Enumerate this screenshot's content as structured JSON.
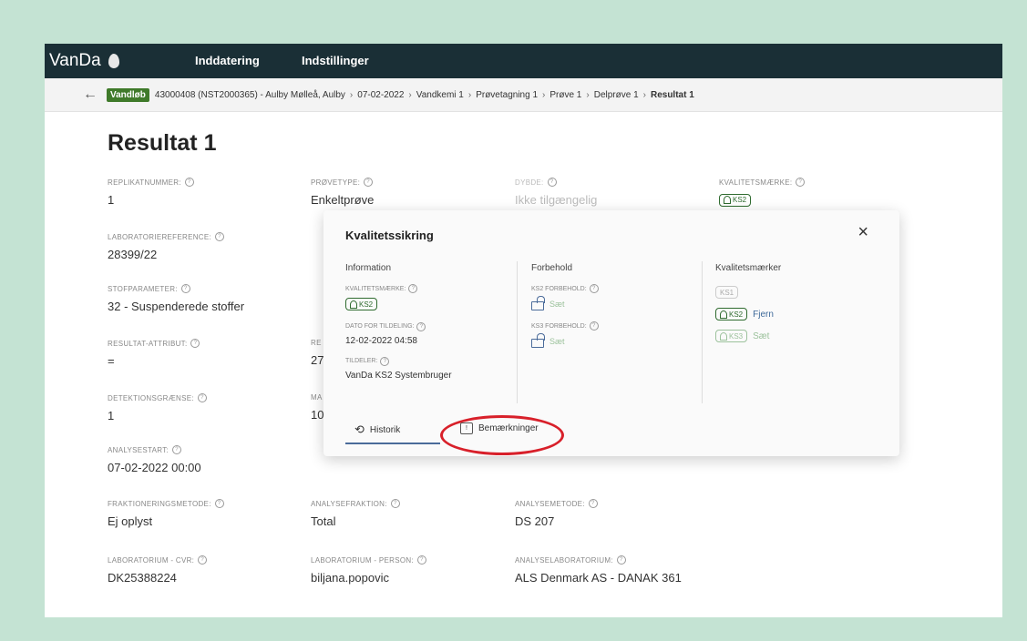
{
  "app": {
    "name": "VanDa"
  },
  "nav": {
    "item1": "Inddatering",
    "item2": "Indstillinger"
  },
  "breadcrumb": {
    "badge": "Vandløb",
    "items": [
      "43000408 (NST2000365) - Aulby Mølleå, Aulby",
      "07-02-2022",
      "Vandkemi 1",
      "Prøvetagning 1",
      "Prøve 1",
      "Delprøve 1"
    ],
    "current": "Resultat 1",
    "separator": "›"
  },
  "page": {
    "title": "Resultat 1"
  },
  "help_glyph": "?",
  "fields": {
    "replikatnummer": {
      "label": "REPLIKATNUMMER:",
      "value": "1"
    },
    "proevetype": {
      "label": "PRØVETYPE:",
      "value": "Enkeltprøve"
    },
    "dybde": {
      "label": "DYBDE:",
      "value": "Ikke tilgængelig"
    },
    "kvalitetsmaerke": {
      "label": "KVALITETSMÆRKE:",
      "value": "KS2"
    },
    "laboratoriereference": {
      "label": "LABORATORIEREFERENCE:",
      "value": "28399/22"
    },
    "stofparameter": {
      "label": "STOFPARAMETER:",
      "value": "32 - Suspenderede stoffer"
    },
    "resultat_attribut": {
      "label": "RESULTAT-ATTRIBUT:",
      "value": "="
    },
    "resultat_partial": {
      "label": "RE",
      "value": "27"
    },
    "detektionsgraense": {
      "label": "DETEKTIONSGRÆNSE:",
      "value": "1"
    },
    "ma_partial": {
      "label": "MA",
      "value": "10"
    },
    "analysestart": {
      "label": "ANALYSESTART:",
      "value": "07-02-2022 00:00"
    },
    "fraktioneringsmetode": {
      "label": "FRAKTIONERINGSMETODE:",
      "value": "Ej oplyst"
    },
    "analysefraktion": {
      "label": "ANALYSEFRAKTION:",
      "value": "Total"
    },
    "analysemetode": {
      "label": "ANALYSEMETODE:",
      "value": "DS 207"
    },
    "laboratorium_cvr": {
      "label": "LABORATORIUM - CVR:",
      "value": "DK25388224"
    },
    "laboratorium_person": {
      "label": "LABORATORIUM - PERSON:",
      "value": "biljana.popovic"
    },
    "analyselaboratorium": {
      "label": "ANALYSELABORATORIUM:",
      "value": "ALS Denmark AS - DANAK 361"
    }
  },
  "modal": {
    "title": "Kvalitetssikring",
    "close": "×",
    "information": {
      "heading": "Information",
      "kvalitetsmaerke_label": "KVALITETSMÆRKE:",
      "kvalitetsmaerke_value": "KS2",
      "dato_label": "DATO FOR TILDELING:",
      "dato_value": "12-02-2022 04:58",
      "tildeler_label": "TILDELER:",
      "tildeler_value": "VanDa KS2 Systembruger"
    },
    "forbehold": {
      "heading": "Forbehold",
      "ks2_label": "KS2 FORBEHOLD:",
      "ks2_action": "Sæt",
      "ks3_label": "KS3 FORBEHOLD:",
      "ks3_action": "Sæt"
    },
    "kvalitetsmaerker": {
      "heading": "Kvalitetsmærker",
      "ks1": "KS1",
      "ks2": "KS2",
      "ks2_action": "Fjern",
      "ks3": "KS3",
      "ks3_action": "Sæt"
    },
    "tabs": {
      "historik": "Historik",
      "bemaerkninger": "Bemærkninger"
    }
  },
  "colors": {
    "topbar": "#1a2f36",
    "background": "#c4e3d3",
    "badge": "#3f7a2a",
    "highlight": "#d8202a"
  }
}
